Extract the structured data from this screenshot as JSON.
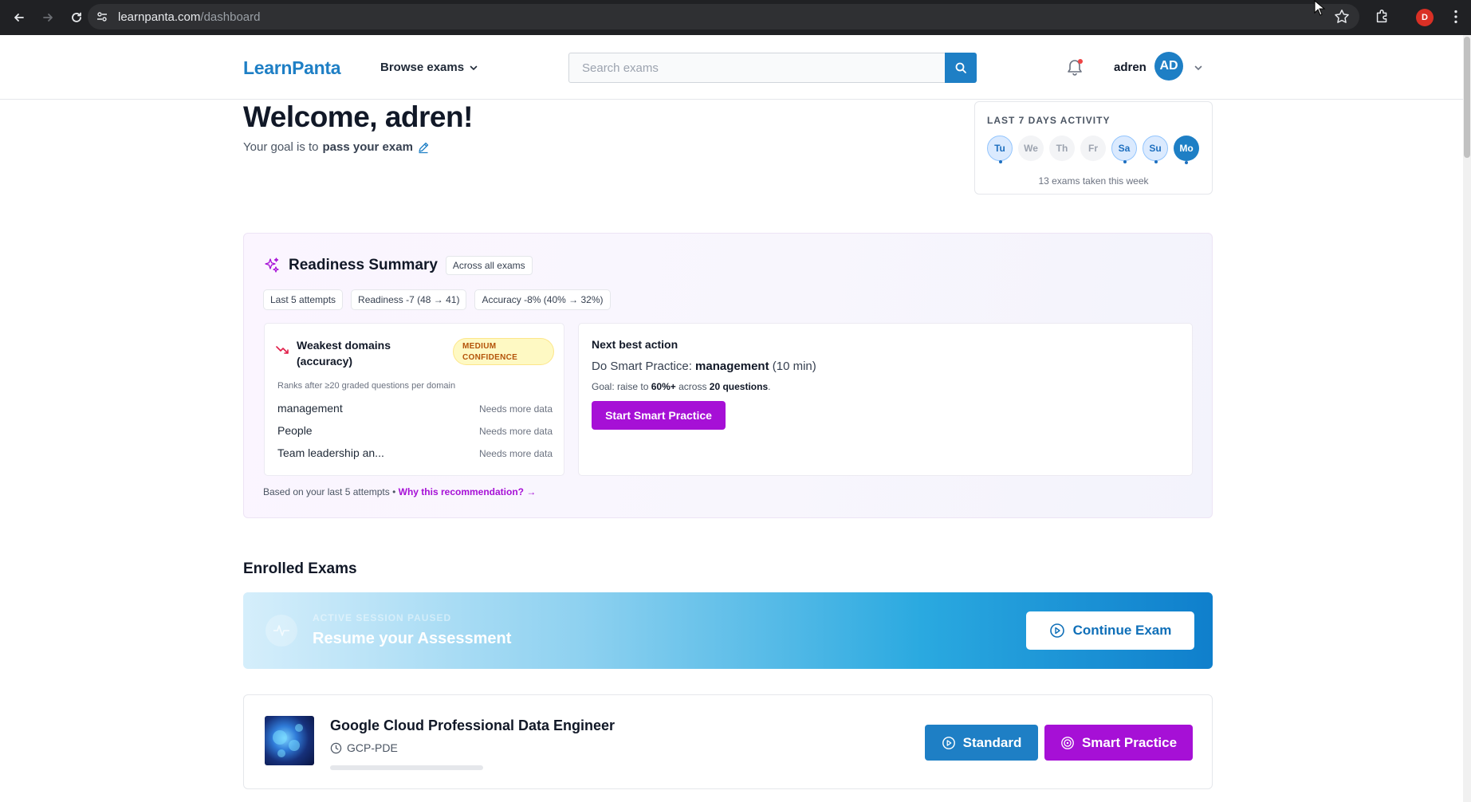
{
  "browser": {
    "url_host": "learnpanta.com",
    "url_path": "/dashboard",
    "profile_initial": "D"
  },
  "header": {
    "logo": "LearnPanta",
    "browse_label": "Browse exams",
    "search_placeholder": "Search exams",
    "username": "adren",
    "avatar_initials": "AD",
    "icons": [
      "search-icon",
      "bell-icon",
      "chevron-down-icon"
    ]
  },
  "welcome": {
    "title": "Welcome, adren!",
    "goal_prefix": "Your goal is to",
    "goal_value": "pass your exam"
  },
  "activity": {
    "title": "LAST 7 DAYS ACTIVITY",
    "days": [
      {
        "label": "Tu",
        "state": "done"
      },
      {
        "label": "We",
        "state": "none"
      },
      {
        "label": "Th",
        "state": "none"
      },
      {
        "label": "Fr",
        "state": "none"
      },
      {
        "label": "Sa",
        "state": "done"
      },
      {
        "label": "Su",
        "state": "done"
      },
      {
        "label": "Mo",
        "state": "today"
      }
    ],
    "summary": "13 exams taken this week"
  },
  "readiness": {
    "title": "Readiness Summary",
    "badge": "Across all exams",
    "chips": [
      "Last 5 attempts",
      "Readiness -7 (48 → 41)",
      "Accuracy -8% (40% → 32%)"
    ],
    "weakest": {
      "title": "Weakest domains (accuracy)",
      "confidence": "MEDIUM CONFIDENCE",
      "note": "Ranks after ≥20 graded questions per domain",
      "domains": [
        {
          "name": "management",
          "status": "Needs more data"
        },
        {
          "name": "People",
          "status": "Needs more data"
        },
        {
          "name": "Team leadership an...",
          "status": "Needs more data"
        }
      ]
    },
    "next_action": {
      "title": "Next best action",
      "do_prefix": "Do Smart Practice:",
      "do_topic": "management",
      "do_suffix": "(10 min)",
      "goal_prefix": "Goal: raise to",
      "goal_target": "60%+",
      "goal_mid": "across",
      "goal_count": "20 questions",
      "goal_end": ".",
      "button": "Start Smart Practice"
    },
    "footer_text": "Based on your last 5 attempts •",
    "footer_link": "Why this recommendation? →"
  },
  "enrolled": {
    "title": "Enrolled Exams",
    "resume": {
      "tag": "ACTIVE SESSION PAUSED",
      "title": "Resume your Assessment",
      "button": "Continue Exam"
    },
    "exams": [
      {
        "name": "Google Cloud Professional Data Engineer",
        "code": "GCP-PDE",
        "progress": 0,
        "standard_label": "Standard",
        "smart_label": "Smart Practice"
      }
    ]
  },
  "colors": {
    "brand_blue": "#1e7fc5",
    "accent_purple": "#a610d6",
    "warning_bg": "#fef9c3"
  }
}
